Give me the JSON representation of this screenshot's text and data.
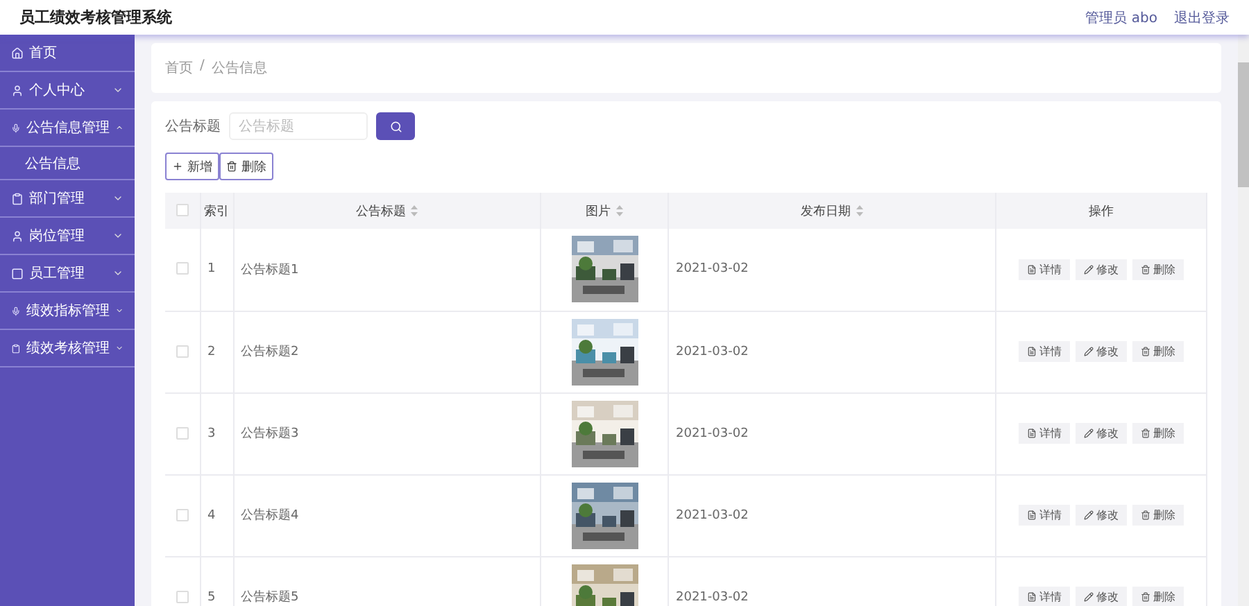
{
  "header": {
    "title": "员工绩效考核管理系统",
    "user": "管理员 abo",
    "logout": "退出登录"
  },
  "sidebar": {
    "items": [
      {
        "label": "首页"
      },
      {
        "label": "个人中心",
        "expanded": false
      },
      {
        "label": "公告信息管理",
        "expanded": true,
        "children": [
          {
            "label": "公告信息"
          }
        ]
      },
      {
        "label": "部门管理",
        "expanded": false
      },
      {
        "label": "岗位管理",
        "expanded": false
      },
      {
        "label": "员工管理",
        "expanded": false
      },
      {
        "label": "绩效指标管理",
        "expanded": false
      },
      {
        "label": "绩效考核管理",
        "expanded": false
      }
    ]
  },
  "breadcrumb": {
    "items": [
      "首页",
      "公告信息"
    ],
    "separator": "/"
  },
  "search": {
    "label": "公告标题",
    "placeholder": "公告标题"
  },
  "toolbar": [
    {
      "label": "新增"
    },
    {
      "label": "删除"
    }
  ],
  "table": {
    "all_checked": false,
    "columns": [
      {
        "label": "索引",
        "sortable": false
      },
      {
        "label": "公告标题",
        "sortable": true
      },
      {
        "label": "图片",
        "sortable": true
      },
      {
        "label": "发布日期",
        "sortable": true
      },
      {
        "label": "操作",
        "sortable": false
      }
    ],
    "rows": [
      {
        "checked": false,
        "index": "1",
        "title": "公告标题1",
        "date": "2021-03-02",
        "actions": [
          "详情",
          "修改",
          "删除"
        ]
      },
      {
        "checked": false,
        "index": "2",
        "title": "公告标题2",
        "date": "2021-03-02",
        "actions": [
          "详情",
          "修改",
          "删除"
        ]
      },
      {
        "checked": false,
        "index": "3",
        "title": "公告标题3",
        "date": "2021-03-02",
        "actions": [
          "详情",
          "修改",
          "删除"
        ]
      },
      {
        "checked": false,
        "index": "4",
        "title": "公告标题4",
        "date": "2021-03-02",
        "actions": [
          "详情",
          "修改",
          "删除"
        ]
      },
      {
        "checked": false,
        "index": "5",
        "title": "公告标题5",
        "date": "2021-03-02",
        "actions": [
          "详情",
          "修改",
          "删除"
        ]
      }
    ]
  }
}
